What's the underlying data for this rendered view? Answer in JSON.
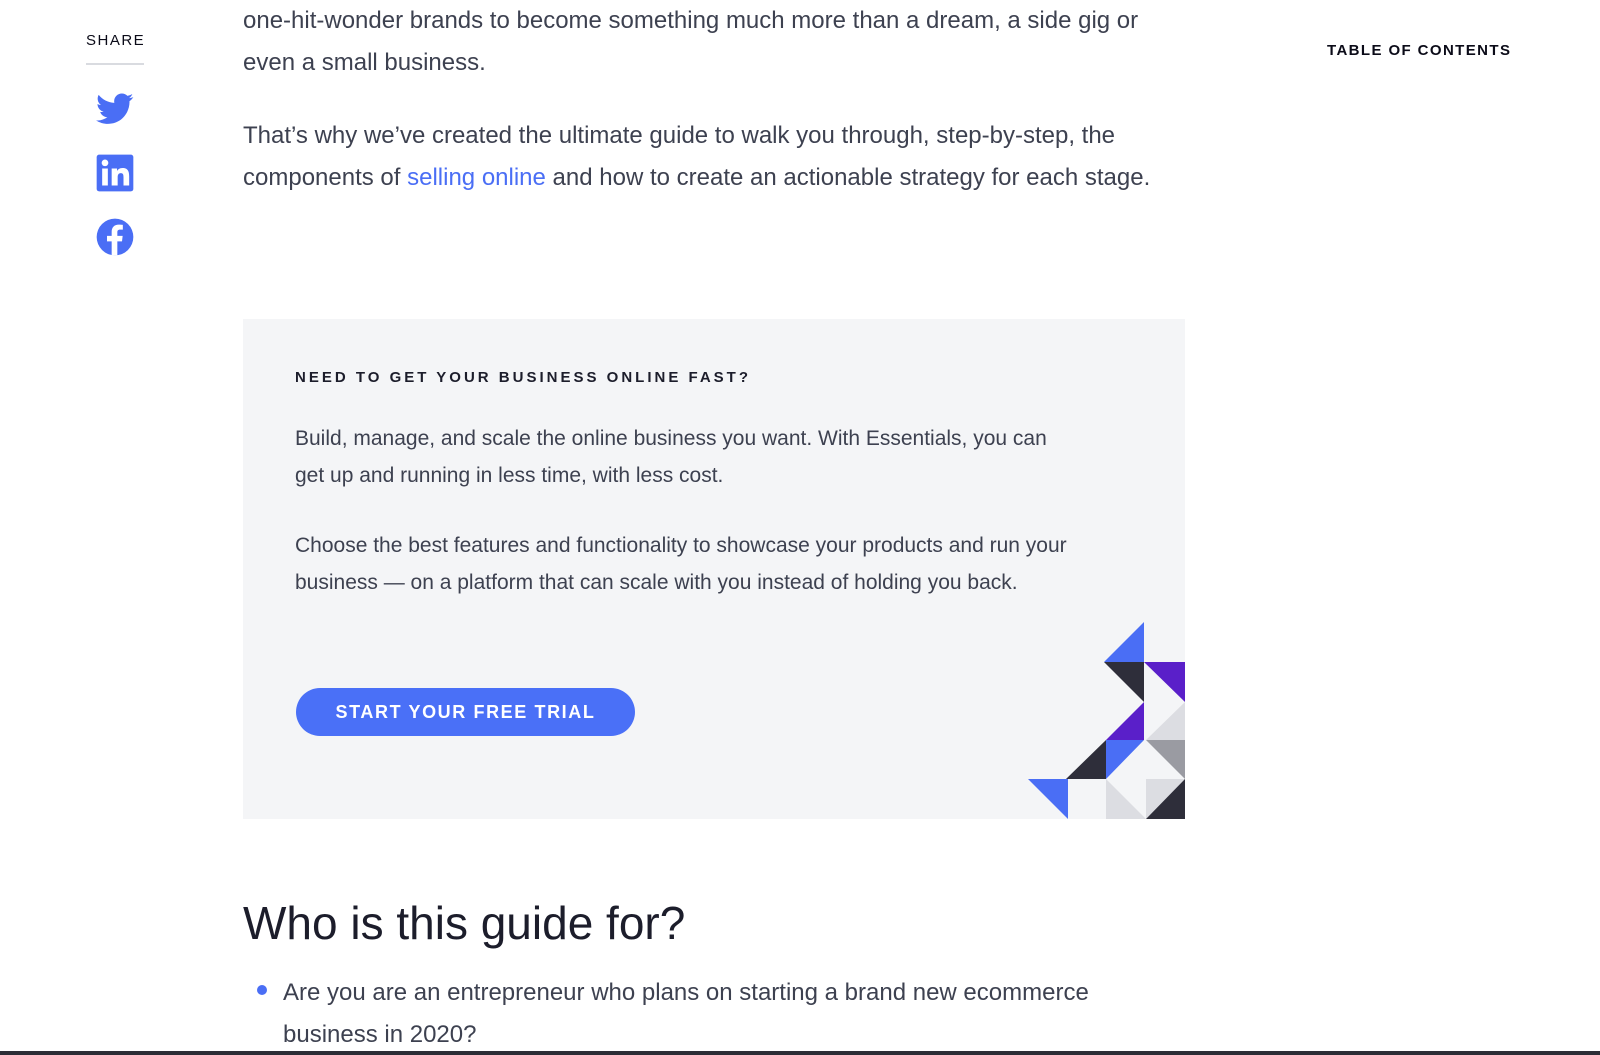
{
  "share": {
    "label": "SHARE",
    "icons": [
      "twitter-icon",
      "linkedin-icon",
      "facebook-icon"
    ]
  },
  "toc": {
    "label": "TABLE OF CONTENTS"
  },
  "article": {
    "intro_text": "one-hit-wonder brands to become something much more than a dream, a side gig or even a small business.",
    "para2_before": "That’s why we’ve created the ultimate guide to walk you through, step-by-step, the components of ",
    "para2_link": "selling online",
    "para2_after": " and how to create an actionable strategy for each stage."
  },
  "cta": {
    "eyebrow": "NEED TO GET YOUR BUSINESS ONLINE FAST?",
    "text1": "Build, manage, and scale the online business you want. With Essentials, you can get up and running in less time, with less cost.",
    "text2": "Choose the best features and functionality to showcase your products and run your business — on a platform that can scale with you instead of holding you back.",
    "button_label": "START YOUR FREE TRIAL"
  },
  "section": {
    "heading": "Who is this guide for?",
    "bullets": [
      "Are you are an entrepreneur who plans on starting a brand new ecommerce business in 2020?"
    ]
  },
  "colors": {
    "accent": "#4a6ef5",
    "text": "#3d4150",
    "heading": "#1c1d2b",
    "card_bg": "#f4f5f7",
    "purple": "#5a1fc9",
    "dark": "#2e2e3a"
  }
}
